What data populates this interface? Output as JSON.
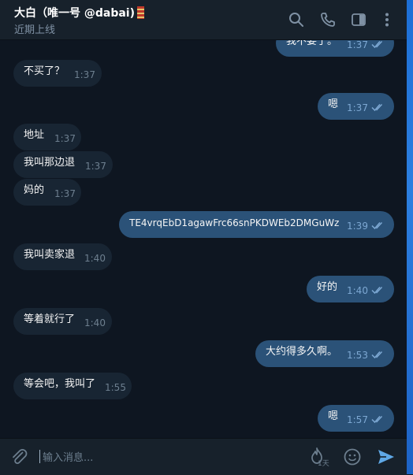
{
  "header": {
    "title": "大白（唯一号 @dabai)",
    "status": "近期上线",
    "icons": [
      "search-icon",
      "phone-icon",
      "sidebar-icon",
      "more-icon"
    ]
  },
  "messages": [
    {
      "dir": "out",
      "text": "我不要了。",
      "time": "1:37"
    },
    {
      "dir": "in",
      "text": "不买了？",
      "time": "1:37"
    },
    {
      "dir": "out",
      "text": "嗯",
      "time": "1:37"
    },
    {
      "dir": "in",
      "text": "地址",
      "time": "1:37"
    },
    {
      "dir": "in",
      "text": "我叫那边退",
      "time": "1:37"
    },
    {
      "dir": "in",
      "text": "妈的",
      "time": "1:37"
    },
    {
      "dir": "out",
      "text": "TE4vrqEbD1agawFrc66snPKDWEb2DMGuWz",
      "time": "1:39"
    },
    {
      "dir": "in",
      "text": "我叫卖家退",
      "time": "1:40"
    },
    {
      "dir": "out",
      "text": "好的",
      "time": "1:40"
    },
    {
      "dir": "in",
      "text": "等着就行了",
      "time": "1:40"
    },
    {
      "dir": "out",
      "text": "大约得多久啊。",
      "time": "1:53"
    },
    {
      "dir": "in",
      "text": "等会吧，我叫了",
      "time": "1:55"
    },
    {
      "dir": "out",
      "text": "嗯",
      "time": "1:57"
    }
  ],
  "composer": {
    "placeholder": "输入消息...",
    "timer_label": "1天",
    "icons": [
      "attach-icon",
      "self-destruct-timer-icon",
      "emoji-icon",
      "send-icon"
    ],
    "accent": "#5fa8e6"
  },
  "colors": {
    "background": "#0e1621",
    "header": "#17212b",
    "incoming_bubble": "#182533",
    "outgoing_bubble": "#2b5278"
  }
}
